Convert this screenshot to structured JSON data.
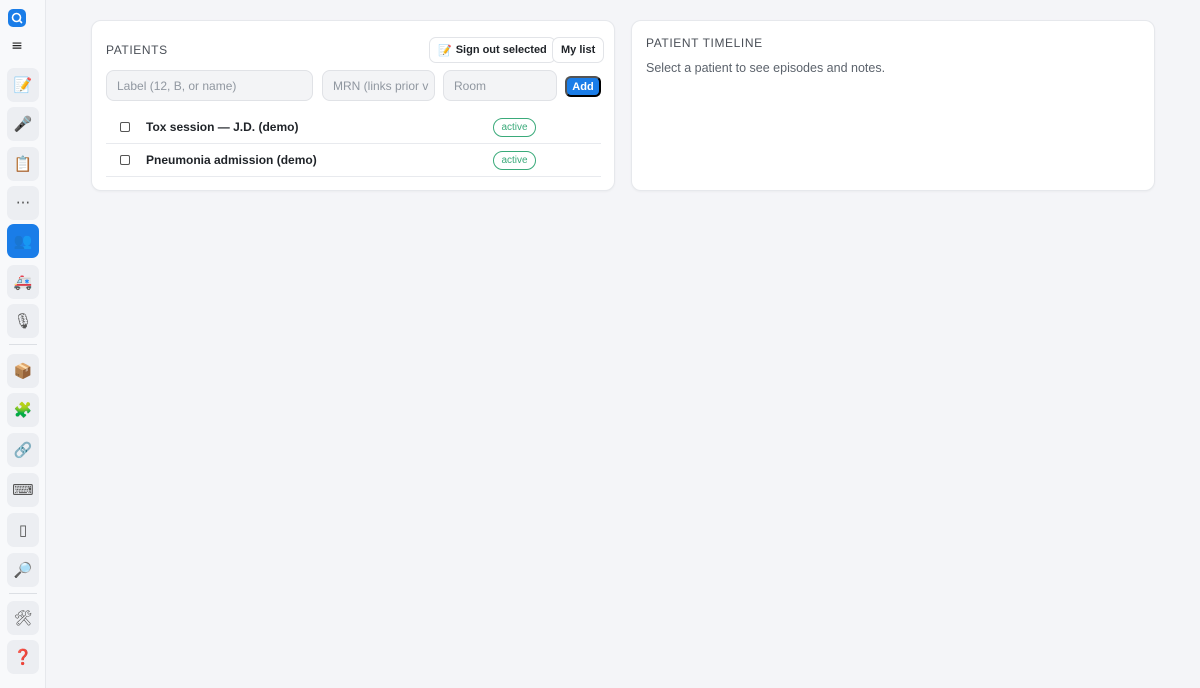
{
  "sidebar": {
    "menu_glyph": "≡",
    "items": [
      {
        "icon": "notes-icon",
        "glyph": "📝",
        "active": false
      },
      {
        "icon": "microphone-icon",
        "glyph": "🎤",
        "active": false
      },
      {
        "icon": "clipboard-icon",
        "glyph": "📋",
        "active": false
      },
      {
        "icon": "more-icon",
        "glyph": "···",
        "active": false
      },
      {
        "icon": "patients-icon",
        "glyph": "👥",
        "active": true
      },
      {
        "icon": "ambulance-icon",
        "glyph": "🚑",
        "active": false
      },
      {
        "icon": "dictation-icon",
        "glyph": "🎙",
        "active": false
      },
      {
        "icon": "box-icon",
        "glyph": "📦",
        "active": false
      },
      {
        "icon": "puzzle-icon",
        "glyph": "🧩",
        "active": false
      },
      {
        "icon": "link-icon",
        "glyph": "🔗",
        "active": false
      },
      {
        "icon": "keyboard-icon",
        "glyph": "⌨",
        "active": false
      },
      {
        "icon": "blank-page-icon",
        "glyph": "▯",
        "active": false
      },
      {
        "icon": "magnifier-icon",
        "glyph": "🔎",
        "active": false
      },
      {
        "icon": "tools-icon",
        "glyph": "🛠",
        "active": false
      },
      {
        "icon": "help-icon",
        "glyph": "❓",
        "active": false
      }
    ],
    "accent": "#1a7de8"
  },
  "patients": {
    "title": "PATIENTS",
    "sign_out_glyph": "📝",
    "sign_out_label": "Sign out selected",
    "my_list_label": "My list",
    "label_placeholder": "Label (12, B, or name)",
    "mrn_placeholder": "MRN (links prior v",
    "room_placeholder": "Room",
    "add_label": "Add",
    "rows": [
      {
        "label": "Tox session — J.D. (demo)",
        "status": "active"
      },
      {
        "label": "Pneumonia admission (demo)",
        "status": "active"
      }
    ],
    "status_color": "#3aaa7a"
  },
  "timeline": {
    "title": "PATIENT TIMELINE",
    "empty_text": "Select a patient to see episodes and notes."
  }
}
